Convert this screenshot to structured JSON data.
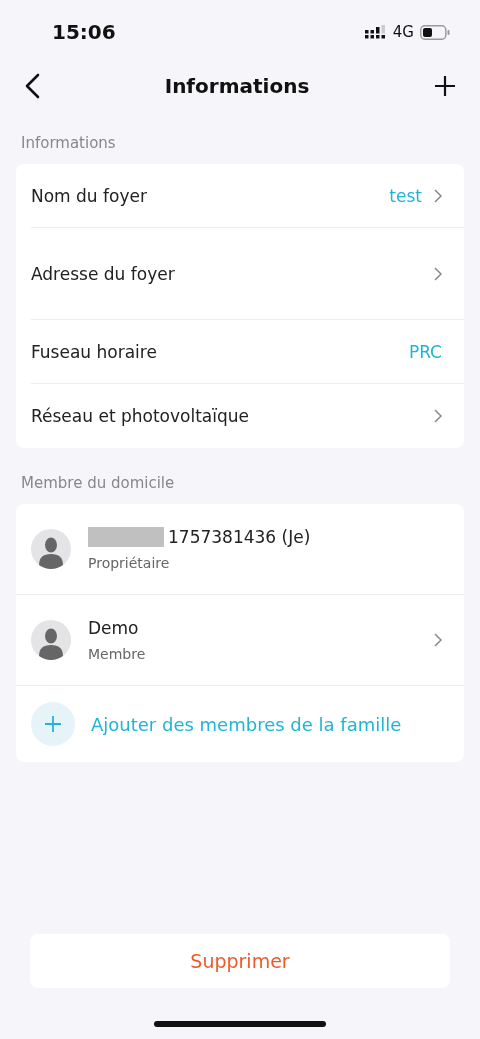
{
  "status_bar": {
    "time": "15:06",
    "network": "4G"
  },
  "header": {
    "title": "Informations"
  },
  "sections": [
    {
      "title": "Informations",
      "rows": [
        {
          "label": "Nom du foyer",
          "value": "test",
          "chevron": true,
          "tall": false
        },
        {
          "label": "Adresse du foyer",
          "chevron": true,
          "tall": true
        },
        {
          "label": "Fuseau horaire",
          "value": "PRC",
          "chevron": false,
          "tall": false
        },
        {
          "label": "Réseau et photovoltaïque",
          "chevron": true,
          "tall": false
        }
      ]
    }
  ],
  "members": {
    "title": "Membre du domicile",
    "items": [
      {
        "name": "1757381436 (Je)",
        "redacted": true,
        "role": "Propriétaire",
        "chevron": false
      },
      {
        "name": "Demo",
        "redacted": false,
        "role": "Membre",
        "chevron": true
      }
    ],
    "add_label": "Ajouter des membres de la famille"
  },
  "delete_button": "Supprimer"
}
